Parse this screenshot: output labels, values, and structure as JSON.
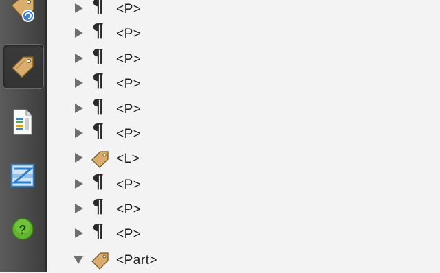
{
  "sidebar": {
    "items": [
      {
        "name": "tags-order-panel",
        "icon": "tag-refresh-icon",
        "active": false
      },
      {
        "name": "tags-panel",
        "icon": "tag-icon",
        "active": true
      },
      {
        "name": "content-panel",
        "icon": "document-icon",
        "active": false
      },
      {
        "name": "reading-order-panel",
        "icon": "reading-order-icon",
        "active": false
      },
      {
        "name": "help",
        "icon": "help-icon",
        "active": false
      }
    ]
  },
  "tree": {
    "rows": [
      {
        "kind": "paragraph",
        "icon": "pilcrow-icon",
        "glyph": "¶",
        "label": "<P>",
        "expanded": false
      },
      {
        "kind": "paragraph",
        "icon": "pilcrow-icon",
        "glyph": "¶",
        "label": "<P>",
        "expanded": false
      },
      {
        "kind": "paragraph",
        "icon": "pilcrow-icon",
        "glyph": "¶",
        "label": "<P>",
        "expanded": false
      },
      {
        "kind": "paragraph",
        "icon": "pilcrow-icon",
        "glyph": "¶",
        "label": "<P>",
        "expanded": false
      },
      {
        "kind": "paragraph",
        "icon": "pilcrow-icon",
        "glyph": "¶",
        "label": "<P>",
        "expanded": false
      },
      {
        "kind": "paragraph",
        "icon": "pilcrow-icon",
        "glyph": "¶",
        "label": "<P>",
        "expanded": false
      },
      {
        "kind": "tag",
        "icon": "tag-icon",
        "label": "<L>",
        "expanded": false
      },
      {
        "kind": "paragraph",
        "icon": "pilcrow-icon",
        "glyph": "¶",
        "label": "<P>",
        "expanded": false
      },
      {
        "kind": "paragraph",
        "icon": "pilcrow-icon",
        "glyph": "¶",
        "label": "<P>",
        "expanded": false
      },
      {
        "kind": "paragraph",
        "icon": "pilcrow-icon",
        "glyph": "¶",
        "label": "<P>",
        "expanded": false
      },
      {
        "kind": "tag",
        "icon": "tag-icon",
        "label": "<Part>",
        "expanded": true
      }
    ]
  },
  "colors": {
    "sidebar_bg": "#4a4a4a",
    "tree_bg": "#f3f3f3",
    "tag_fill": "#d9ae6c",
    "help_green": "#5fb52d",
    "reading_order_blue": "#2f7fc8"
  }
}
